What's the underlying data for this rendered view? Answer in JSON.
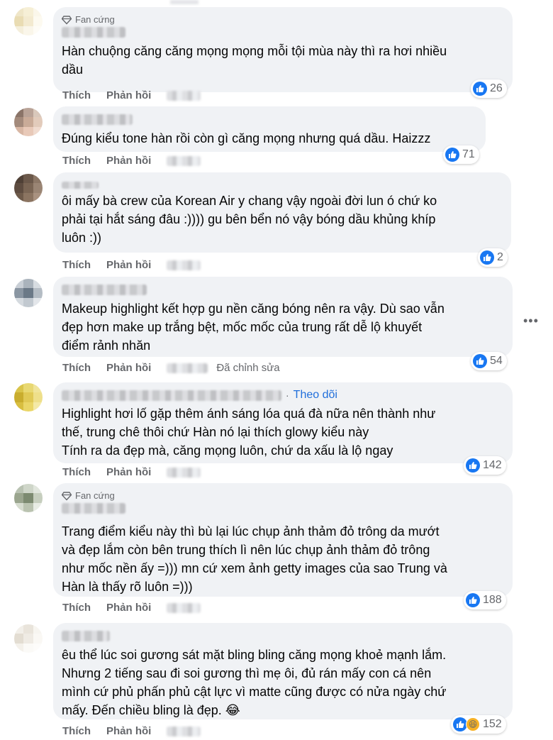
{
  "colors": {
    "bubble": "#f0f2f5",
    "like": "#1877f2",
    "meta": "#65676b",
    "follow": "#216fdb"
  },
  "actions": {
    "like": "Thích",
    "reply": "Phản hồi",
    "edited": "Đã chỉnh sửa",
    "follow": "Theo dõi",
    "fan_badge": "Fan cứng"
  },
  "comments": [
    {
      "text": "Hàn chuộng căng căng mọng mọng mỗi tội mùa này thì ra hơi nhiều\ndầu",
      "reactions": "26",
      "badge": true
    },
    {
      "text": "Đúng kiểu tone hàn rồi còn gì căng mọng nhưng quá dầu. Haizzz",
      "reactions": "71"
    },
    {
      "text": "ôi mấy bà crew của Korean Air y chang vậy ngoài đời lun ó chứ ko\nphải tại hắt sáng đâu :)))) gu bên bển nó vậy bóng dầu khủng khíp\nluôn :))",
      "reactions": "2"
    },
    {
      "text": "Makeup highlight kết hợp gu nền căng bóng nên ra vậy. Dù sao vẫn\nđẹp hơn make up trắng bệt, mốc mốc của trung rất dễ lộ khuyết\nđiểm rảnh nhăn",
      "reactions": "54",
      "edited": true
    },
    {
      "text": "Highlight hơi lố gặp thêm ánh sáng lóa quá đà nữa nên thành như\nthế, trung chê thôi chứ Hàn nó lại thích glowy kiểu này\nTính ra da đẹp mà, căng mọng luôn, chứ da xấu là lộ ngay",
      "reactions": "142",
      "follow": true
    },
    {
      "text": "Trang điểm kiểu này thì bù lại lúc chụp ảnh thảm đỏ trông da mướt\nvà đẹp lắm còn bên trung thích lì nên lúc chụp ảnh thảm đỏ trông\nnhư mốc nền ấy =))) mn cứ xem ảnh getty images của sao Trung và\nHàn là thấy rõ luôn =)))",
      "reactions": "188",
      "badge": true
    },
    {
      "text": "êu thể lúc soi gương sát mặt bling bling căng mọng khoẻ mạnh lắm.\nNhưng 2 tiếng sau đi soi gương thì mẹ ôi, đủ rán mấy con cá nên\nmình cứ phủ phấn phủ cật lực vì matte cũng được có nửa ngày chứ\nmấy. Đến chiều bling là đẹp. 😂",
      "reactions": "152",
      "haha": true
    }
  ]
}
